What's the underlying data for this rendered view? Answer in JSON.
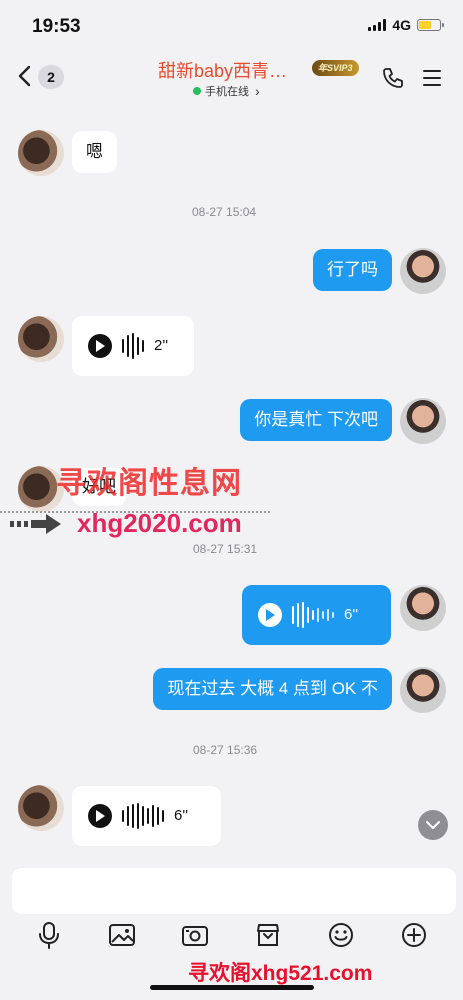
{
  "status": {
    "time": "19:53",
    "network": "4G"
  },
  "nav": {
    "unread_count": "2",
    "title": "甜新baby西青…",
    "vip_badge": "年SVIP3",
    "online_status": "手机在线",
    "online_chevron": "›"
  },
  "messages": [
    {
      "kind": "text",
      "side": "in",
      "text": "嗯"
    },
    {
      "kind": "time",
      "text": "08-27 15:04"
    },
    {
      "kind": "text",
      "side": "out",
      "text": "行了吗"
    },
    {
      "kind": "voice",
      "side": "in",
      "duration": "2''"
    },
    {
      "kind": "text",
      "side": "out",
      "text": "你是真忙  下次吧"
    },
    {
      "kind": "text",
      "side": "in",
      "text": "好吧"
    },
    {
      "kind": "time",
      "text": "08-27 15:31"
    },
    {
      "kind": "voice",
      "side": "out",
      "duration": "6''"
    },
    {
      "kind": "text",
      "side": "out",
      "text": "现在过去 大概 4 点到 OK 不"
    },
    {
      "kind": "time",
      "text": "08-27 15:36"
    },
    {
      "kind": "voice",
      "side": "in",
      "duration": "6''"
    }
  ],
  "watermarks": {
    "top": "寻欢阁性息网",
    "middle": "xhg2020.com",
    "bottom": "寻欢阁xhg521.com"
  },
  "input": {
    "placeholder": ""
  },
  "toolbar": {
    "icons": [
      "microphone-icon",
      "image-icon",
      "camera-icon",
      "gift-box-icon",
      "emoji-icon",
      "plus-icon"
    ]
  },
  "colors": {
    "accent": "#1e9bf0",
    "title": "#ea4b2b",
    "online": "#26c15a"
  }
}
